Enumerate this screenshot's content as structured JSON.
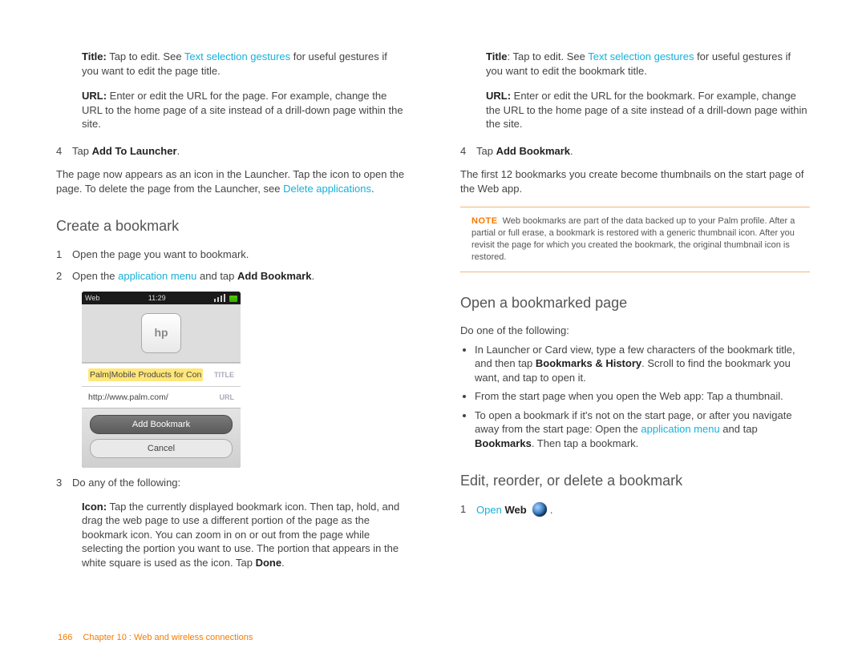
{
  "col1": {
    "title_label": "Title:",
    "title_text1": " Tap to edit. See ",
    "title_link": "Text selection gestures",
    "title_text2": " for useful gestures if you want to edit the page title.",
    "url_label": "URL:",
    "url_text": " Enter or edit the URL for the page. For example, change the URL to the home page of a site instead of a drill-down page within the site.",
    "step4_n": "4",
    "step4_t1": "Tap ",
    "step4_b": "Add To Launcher",
    "step4_t2": ".",
    "after4_t1": "The page now appears as an icon in the Launcher. Tap the icon to open the page. To delete the page from the Launcher, see ",
    "after4_link": "Delete applications",
    "after4_t2": ".",
    "h2_create": "Create a bookmark",
    "s1_n": "1",
    "s1_t": "Open the page you want to bookmark.",
    "s2_n": "2",
    "s2_t1": "Open the ",
    "s2_link": "application menu",
    "s2_t2": " and tap ",
    "s2_b": "Add Bookmark",
    "s2_t3": ".",
    "phone": {
      "status_left": "Web",
      "status_time": "11:29",
      "thumb_label": "hp",
      "title_val": "Palm|Mobile Products for Con",
      "title_lbl": "TITLE",
      "url_val": "http://www.palm.com/",
      "url_lbl": "URL",
      "btn_add": "Add Bookmark",
      "btn_cancel": "Cancel"
    },
    "s3_n": "3",
    "s3_t": "Do any of the following:",
    "icon_label": "Icon:",
    "icon_text1": " Tap the currently displayed bookmark icon. Then tap, hold, and drag the web page to use a different portion of the page as the bookmark icon. You can zoom in on or out from the page while selecting the portion you want to use. The portion that appears in the white square is used as the icon. Tap ",
    "icon_b": "Done",
    "icon_text2": "."
  },
  "col2": {
    "title_label": "Title",
    "title_text1": ": Tap to edit. See ",
    "title_link": "Text selection gestures",
    "title_text2": " for useful gestures if you want to edit the bookmark title.",
    "url_label": "URL:",
    "url_text": " Enter or edit the URL for the bookmark. For example, change the URL to the home page of a site instead of a drill-down page within the site.",
    "step4_n": "4",
    "step4_t1": "Tap ",
    "step4_b": "Add Bookmark",
    "step4_t2": ".",
    "after4": "The first 12 bookmarks you create become thumbnails on the start page of the Web app.",
    "note_lbl": "NOTE",
    "note_text": "Web bookmarks are part of the data backed up to your Palm profile. After a partial or full erase, a bookmark is restored with a generic thumbnail icon. After you revisit the page for which you created the bookmark, the original thumbnail icon is restored.",
    "h2_open": "Open a bookmarked page",
    "do_one": "Do one of the following:",
    "bul1a": "In Launcher or Card view, type a few characters of the bookmark title, and then tap ",
    "bul1b": "Bookmarks & History",
    "bul1c": ". Scroll to find the bookmark you want, and tap to open it.",
    "bul2": "From the start page when you open the Web app: Tap a thumbnail.",
    "bul3a": "To open a bookmark if it's not on the start page, or after you navigate away from the start page: Open the ",
    "bul3link": "application menu",
    "bul3b": " and tap ",
    "bul3bold": "Bookmarks",
    "bul3c": ". Then tap a bookmark.",
    "h2_edit": "Edit, reorder, or delete a bookmark",
    "s1_n": "1",
    "s1_link": "Open",
    "s1_b": "Web",
    "s1_t2": " ."
  },
  "footer": {
    "page": "166",
    "ch": "Chapter 10 : Web and wireless connections"
  }
}
